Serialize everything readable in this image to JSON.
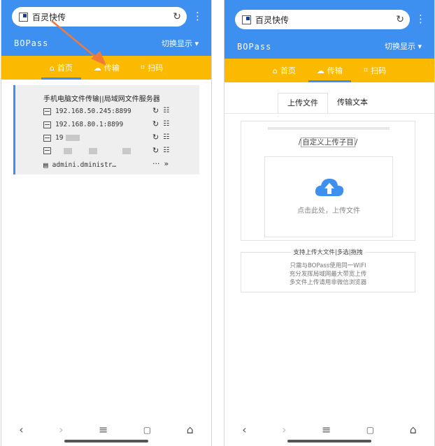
{
  "browser": {
    "url": "百灵快传"
  },
  "header": {
    "brand": "BOPass",
    "switch_label": "切换显示"
  },
  "tabs": [
    {
      "label": "首页",
      "icon": "home-icon"
    },
    {
      "label": "传输",
      "icon": "cloud-upload-icon"
    },
    {
      "label": "扫码",
      "icon": "scan-icon"
    }
  ],
  "left": {
    "active_tab": "传输",
    "card": {
      "title": "手机电脑文件传输||局域网文件服务器",
      "addresses": [
        "192.168.50.245:8899",
        "192.168.80.1:8899",
        "19"
      ],
      "admin_text": "admini.dministr…"
    }
  },
  "right": {
    "subtabs": [
      {
        "label": "上传文件",
        "active": true
      },
      {
        "label": "传输文本",
        "active": false
      }
    ],
    "subdir_label": "自定义上传子目",
    "drop_text": "点击此处，上传文件",
    "info_head": "支持上传大文件|多选|拖拽",
    "info_lines": [
      "只需与BOPass使用同一WIFI",
      "充分发挥局域网最大带宽上传",
      "多文件上传请用非微信浏览器"
    ]
  },
  "colors": {
    "primary": "#3d8ff0",
    "tabbar": "#fbb900",
    "arrow": "#f07a3a"
  },
  "nav": [
    "back-icon",
    "forward-icon",
    "menu-icon",
    "tabs-icon",
    "home-icon"
  ]
}
